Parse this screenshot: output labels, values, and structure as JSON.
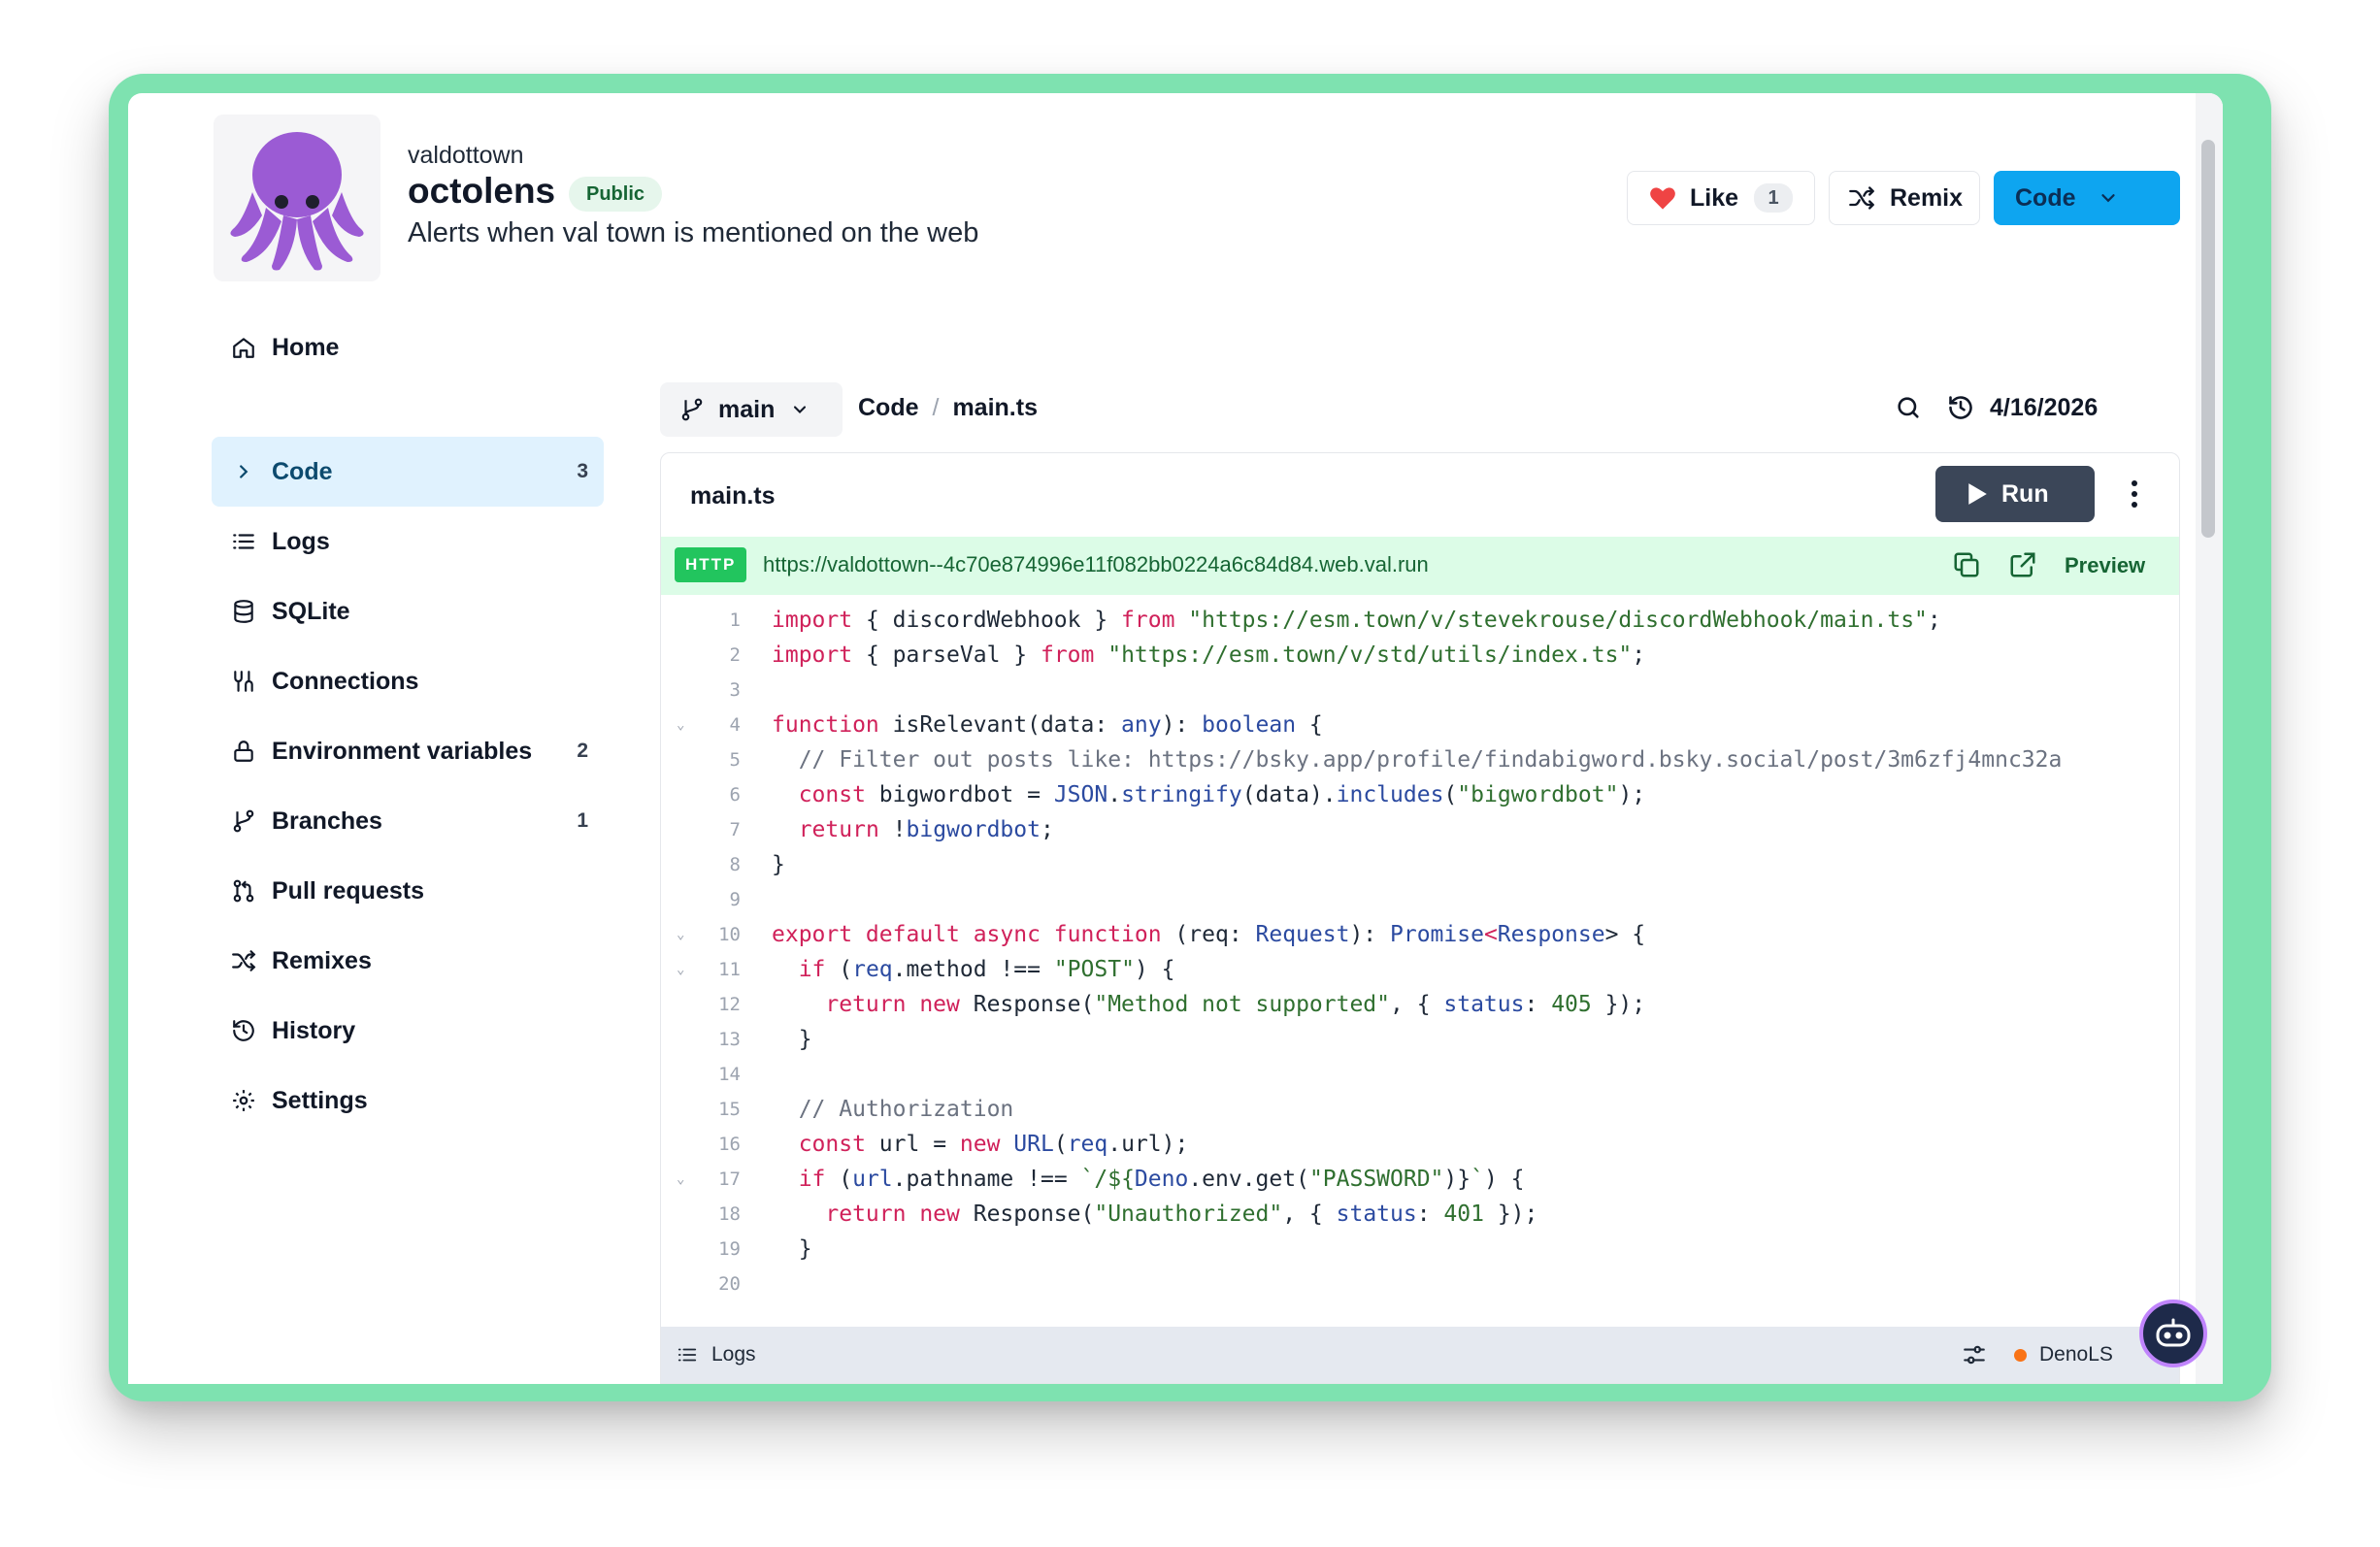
{
  "header": {
    "owner": "valdottown",
    "val_name": "octolens",
    "visibility": "Public",
    "description": "Alerts when val town is mentioned on the web",
    "like_label": "Like",
    "like_count": "1",
    "remix_label": "Remix",
    "code_label": "Code"
  },
  "sidebar": {
    "items": [
      {
        "label": "Home",
        "count": "",
        "icon": "home-icon"
      },
      {
        "label": "Code",
        "count": "3",
        "icon": "chevron-right-icon"
      },
      {
        "label": "Logs",
        "count": "",
        "icon": "list-icon"
      },
      {
        "label": "SQLite",
        "count": "",
        "icon": "database-icon"
      },
      {
        "label": "Connections",
        "count": "",
        "icon": "connections-icon"
      },
      {
        "label": "Environment variables",
        "count": "2",
        "icon": "lock-icon"
      },
      {
        "label": "Branches",
        "count": "1",
        "icon": "git-branch-icon"
      },
      {
        "label": "Pull requests",
        "count": "",
        "icon": "git-pull-request-icon"
      },
      {
        "label": "Remixes",
        "count": "",
        "icon": "shuffle-icon"
      },
      {
        "label": "History",
        "count": "",
        "icon": "history-icon"
      },
      {
        "label": "Settings",
        "count": "",
        "icon": "gear-icon"
      }
    ]
  },
  "breadcrumb": {
    "branch": "main",
    "section": "Code",
    "separator": "/",
    "file": "main.ts",
    "date": "4/16/2026"
  },
  "editor": {
    "file_title": "main.ts",
    "run_label": "Run",
    "http_badge": "HTTP",
    "url": "https://valdottown--4c70e874996e11f082bb0224a6c84d84.web.val.run",
    "preview_label": "Preview",
    "lines": [
      {
        "n": "1"
      },
      {
        "n": "2"
      },
      {
        "n": "3"
      },
      {
        "n": "4"
      },
      {
        "n": "5"
      },
      {
        "n": "6"
      },
      {
        "n": "7"
      },
      {
        "n": "8"
      },
      {
        "n": "9"
      },
      {
        "n": "10"
      },
      {
        "n": "11"
      },
      {
        "n": "12"
      },
      {
        "n": "13"
      },
      {
        "n": "14"
      },
      {
        "n": "15"
      },
      {
        "n": "16"
      },
      {
        "n": "17"
      },
      {
        "n": "18"
      },
      {
        "n": "19"
      },
      {
        "n": "20"
      }
    ],
    "code_lines": [
      [
        [
          "kw",
          "import"
        ],
        [
          "p",
          " { discordWebhook } "
        ],
        [
          "kw",
          "from"
        ],
        [
          "p",
          " "
        ],
        [
          "str",
          "\"https://esm.town/v/stevekrouse/discordWebhook/main.ts\""
        ],
        [
          "p",
          ";"
        ]
      ],
      [
        [
          "kw",
          "import"
        ],
        [
          "p",
          " { parseVal } "
        ],
        [
          "kw",
          "from"
        ],
        [
          "p",
          " "
        ],
        [
          "str",
          "\"https://esm.town/v/std/utils/index.ts\""
        ],
        [
          "p",
          ";"
        ]
      ],
      [],
      [
        [
          "kw",
          "function"
        ],
        [
          "p",
          " isRelevant(data: "
        ],
        [
          "ty",
          "any"
        ],
        [
          "p",
          "): "
        ],
        [
          "ty",
          "boolean"
        ],
        [
          "p",
          " {"
        ]
      ],
      [
        [
          "p",
          "  "
        ],
        [
          "cm",
          "// Filter out posts like: https://bsky.app/profile/findabigword.bsky.social/post/3m6zfj4mnc32a"
        ]
      ],
      [
        [
          "p",
          "  "
        ],
        [
          "kw",
          "const"
        ],
        [
          "p",
          " bigwordbot = "
        ],
        [
          "ty",
          "JSON"
        ],
        [
          "p",
          "."
        ],
        [
          "ty",
          "stringify"
        ],
        [
          "p",
          "(data)."
        ],
        [
          "ty",
          "includes"
        ],
        [
          "p",
          "("
        ],
        [
          "str",
          "\"bigwordbot\""
        ],
        [
          "p",
          ");"
        ]
      ],
      [
        [
          "p",
          "  "
        ],
        [
          "kw",
          "return"
        ],
        [
          "p",
          " !"
        ],
        [
          "ty",
          "bigwordbot"
        ],
        [
          "p",
          ";"
        ]
      ],
      [
        [
          "p",
          "}"
        ]
      ],
      [],
      [
        [
          "kw",
          "export default async function"
        ],
        [
          "p",
          " (req: "
        ],
        [
          "ty",
          "Request"
        ],
        [
          "p",
          "): "
        ],
        [
          "ty",
          "Promise"
        ],
        [
          "kw",
          "<"
        ],
        [
          "ty",
          "Response"
        ],
        [
          "p",
          "> {"
        ]
      ],
      [
        [
          "p",
          "  "
        ],
        [
          "kw",
          "if"
        ],
        [
          "p",
          " ("
        ],
        [
          "ty",
          "req"
        ],
        [
          "p",
          ".method !== "
        ],
        [
          "str",
          "\"POST\""
        ],
        [
          "p",
          ") {"
        ]
      ],
      [
        [
          "p",
          "    "
        ],
        [
          "kw",
          "return new"
        ],
        [
          "p",
          " Response("
        ],
        [
          "str",
          "\"Method not supported\""
        ],
        [
          "p",
          ", { "
        ],
        [
          "ty",
          "status"
        ],
        [
          "p",
          ": "
        ],
        [
          "str",
          "405"
        ],
        [
          "p",
          " });"
        ]
      ],
      [
        [
          "p",
          "  }"
        ]
      ],
      [],
      [
        [
          "p",
          "  "
        ],
        [
          "cm",
          "// Authorization"
        ]
      ],
      [
        [
          "p",
          "  "
        ],
        [
          "kw",
          "const"
        ],
        [
          "p",
          " url = "
        ],
        [
          "kw",
          "new"
        ],
        [
          "p",
          " "
        ],
        [
          "ty",
          "URL"
        ],
        [
          "p",
          "("
        ],
        [
          "ty",
          "req"
        ],
        [
          "p",
          ".url);"
        ]
      ],
      [
        [
          "p",
          "  "
        ],
        [
          "kw",
          "if"
        ],
        [
          "p",
          " ("
        ],
        [
          "ty",
          "url"
        ],
        [
          "p",
          ".pathname !== "
        ],
        [
          "str",
          "`/${"
        ],
        [
          "ty",
          "Deno"
        ],
        [
          "p",
          ".env.get("
        ],
        [
          "str",
          "\"PASSWORD\""
        ],
        [
          "p",
          ")}"
        ],
        [
          "str",
          "`"
        ],
        [
          "p",
          ") {"
        ]
      ],
      [
        [
          "p",
          "    "
        ],
        [
          "kw",
          "return new"
        ],
        [
          "p",
          " Response("
        ],
        [
          "str",
          "\"Unauthorized\""
        ],
        [
          "p",
          ", { "
        ],
        [
          "ty",
          "status"
        ],
        [
          "p",
          ": "
        ],
        [
          "str",
          "401"
        ],
        [
          "p",
          " });"
        ]
      ],
      [
        [
          "p",
          "  }"
        ]
      ],
      []
    ],
    "folds": [
      "4",
      "10",
      "11",
      "17"
    ]
  },
  "statusbar": {
    "logs_label": "Logs",
    "lsp_label": "DenoLS"
  },
  "colors": {
    "frame": "#7ee2b0",
    "accent": "#0ea5f0",
    "keyword": "#d0215a",
    "string": "#2f6f2f",
    "type": "#2b4aa0"
  }
}
